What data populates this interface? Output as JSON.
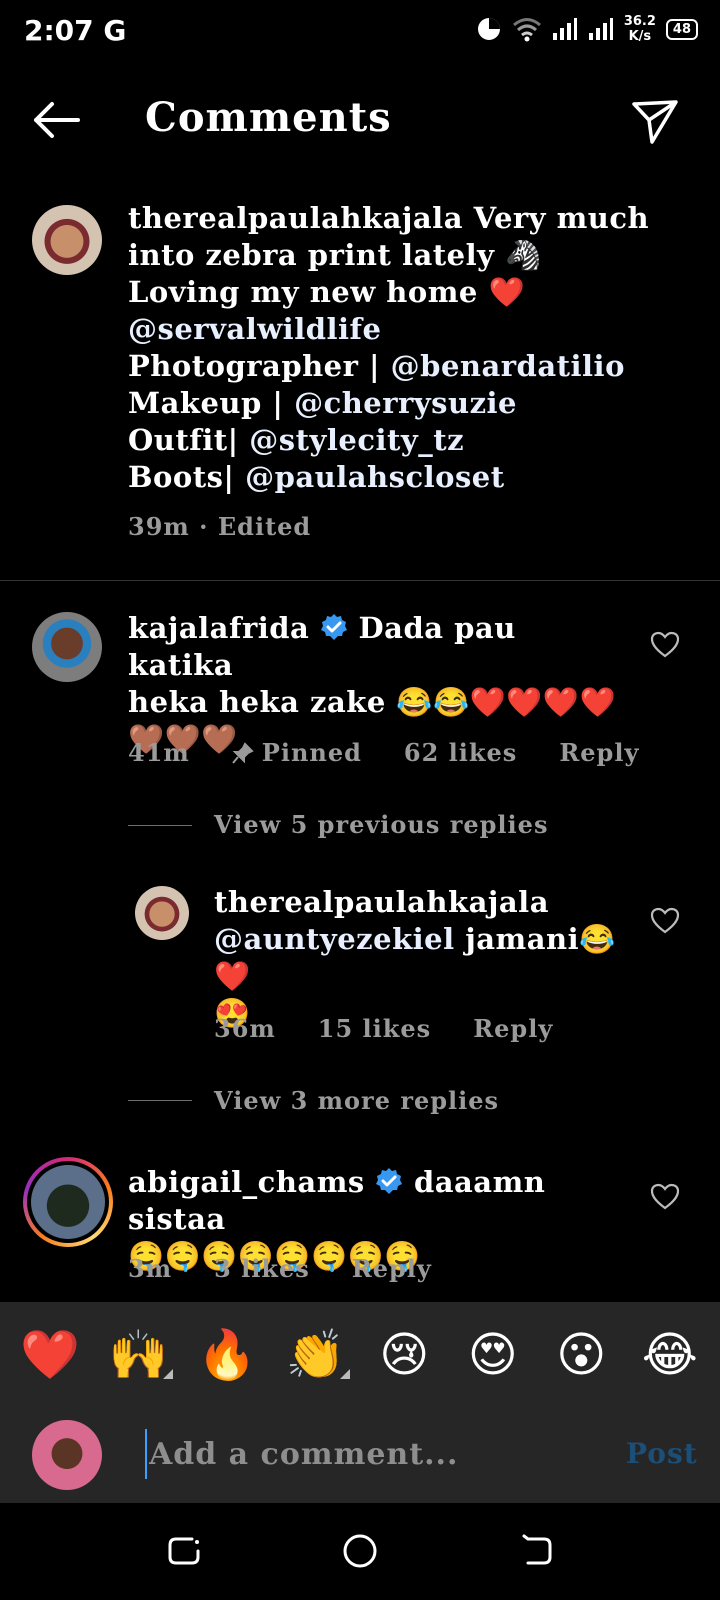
{
  "status_bar": {
    "time": "2:07",
    "carrier_icon": "G",
    "speed_value": "36.2",
    "speed_unit": "K/s",
    "battery": "48"
  },
  "header": {
    "title": "Comments"
  },
  "caption": {
    "username": "therealpaulahkajala",
    "line1_text": "Very much into zebra print lately 🦓",
    "line2_text": "Loving my new home ❤️",
    "mention_home": "@servalwildlife",
    "photographer_label": "Photographer |",
    "photographer_mention": "@benardatilio",
    "makeup_label": "Makeup |",
    "makeup_mention": "@cherrysuzie",
    "outfit_label": "Outfit|",
    "outfit_mention": "@stylecity_tz",
    "boots_label": "Boots|",
    "boots_mention": "@paulahscloset",
    "time": "39m",
    "separator": "·",
    "edited": "Edited"
  },
  "comments": [
    {
      "username": "kajalafrida",
      "verified": true,
      "text_line1": "Dada pau katika",
      "text_line2": "heka heka zake 😂😂❤️❤️❤️❤️",
      "text_line3": "🤎🤎🤎",
      "time": "41m",
      "pinned": "Pinned",
      "likes": "62 likes",
      "reply": "Reply",
      "view_previous": "View 5 previous replies",
      "view_more": "View 3 more replies",
      "reply_item": {
        "username": "therealpaulahkajala",
        "mention": "@auntyezekiel",
        "text": "jamani😂❤️",
        "text_line2": "😍",
        "time": "36m",
        "likes": "15 likes",
        "reply": "Reply"
      }
    },
    {
      "username": "abigail_chams",
      "verified": true,
      "text_line1": "daaamn sistaa",
      "text_line2": "🤤🤤🤤🤤🤤🤤🤤🤤",
      "time": "3m",
      "likes": "3 likes",
      "reply": "Reply"
    }
  ],
  "emoji_bar": [
    "❤️",
    "🙌",
    "🔥",
    "👏",
    "😢",
    "😍",
    "😮",
    "😂"
  ],
  "comment_input": {
    "placeholder": "Add a comment...",
    "post_label": "Post"
  },
  "colors": {
    "background": "#000000",
    "verified_blue": "#3897f0",
    "post_disabled": "#1c4f78",
    "panel": "#262626"
  }
}
